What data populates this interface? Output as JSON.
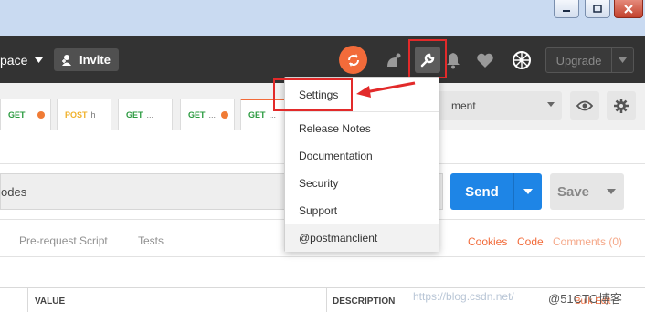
{
  "header": {
    "workspace_label": "pace",
    "invite_label": "Invite",
    "upgrade_label": "Upgrade"
  },
  "tabs": [
    {
      "method": "GET",
      "name": "",
      "color": "#2a9a3f",
      "modified": true
    },
    {
      "method": "POST",
      "name": "h",
      "color": "#f0b12a",
      "modified": false
    },
    {
      "method": "GET",
      "name": "...",
      "color": "#2a9a3f",
      "modified": false
    },
    {
      "method": "GET",
      "name": "...",
      "color": "#2a9a3f",
      "modified": true
    },
    {
      "method": "GET",
      "name": "...",
      "color": "#2a9a3f",
      "modified": false
    }
  ],
  "environment": {
    "selected": "ment"
  },
  "request": {
    "url_value": "odes",
    "send_label": "Send",
    "save_label": "Save"
  },
  "subtabs": {
    "pre_request": "Pre-request Script",
    "tests": "Tests",
    "cookies": "Cookies",
    "code": "Code",
    "comments": "Comments (0)"
  },
  "table": {
    "value_col": "VALUE",
    "description_col": "DESCRIPTION",
    "bulk_edit": "Bulk Edit"
  },
  "menu": {
    "items": [
      "Settings",
      "Release Notes",
      "Documentation",
      "Security",
      "Support"
    ],
    "footer": "@postmanclient"
  },
  "watermark": {
    "left": "https://blog.csdn.net/",
    "right": "@51CTO博客"
  },
  "colors": {
    "accent": "#f26b3a",
    "send": "#1e85e6",
    "annotation": "#e22a2a"
  }
}
